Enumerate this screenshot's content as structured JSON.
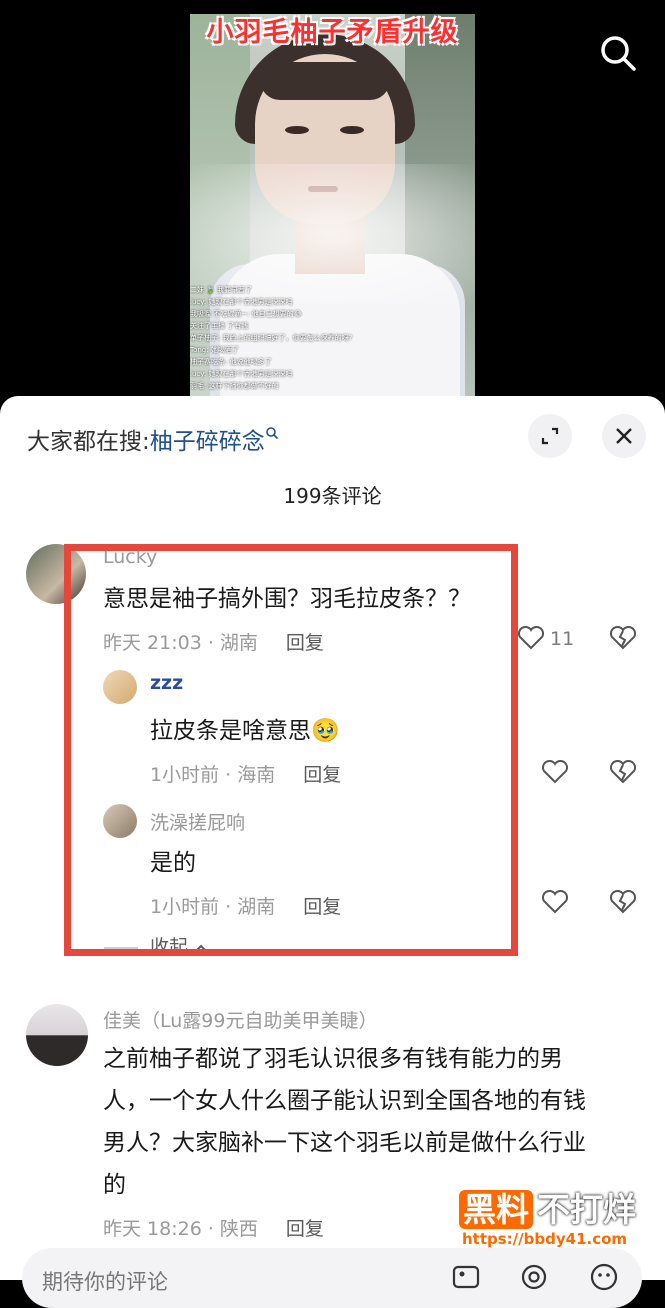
{
  "video": {
    "title": "小羽毛柚子矛盾升级",
    "live_comments": [
      "二妹 🍃  我要录音了",
      "lucy: 她现在那个香港男是深深吗",
      "我吸溜 不吃碳滴~: 他自己想要的😂",
      "关注了主播 了有钱",
      "单子柚子: 我脸上的组织搞好了，你要怎么保养的呀?",
      "Tong: 她喝酒了",
      "柚子赛吃条: 他说他喝多了",
      "lucy: 她现在那个香港男是深深吗",
      "羽毛: 这样下播你都做不好的"
    ]
  },
  "header": {
    "hot_search_label": "大家都在搜:",
    "hot_search_keyword": "柚子碎碎念",
    "comment_count": "199条评论"
  },
  "comments": [
    {
      "name": "Lucky",
      "text": "意思是袖子搞外围？羽毛拉皮条？？",
      "meta": "昨天 21:03 · 湖南",
      "reply_label": "回复",
      "likes": "11",
      "replies": [
        {
          "name": "zzz",
          "text": "拉皮条是啥意思🥹",
          "meta": "1小时前 · 海南",
          "reply_label": "回复"
        },
        {
          "name": "洗澡搓屁响",
          "text": "是的",
          "meta": "1小时前 · 湖南",
          "reply_label": "回复"
        }
      ],
      "collapse_label": "收起"
    },
    {
      "name": "佳美（Lu露99元自助美甲美睫）",
      "text_lines": [
        "之前柚子都说了羽毛认识很多有钱有能力的男",
        "人，一个女人什么圈子能认识到全国各地的有钱",
        "男人？大家脑补一下这个羽毛以前是做什么行业",
        "的"
      ],
      "meta": "昨天 18:26 · 陕西",
      "reply_label": "回复"
    }
  ],
  "input": {
    "placeholder": "期待你的评论"
  },
  "watermark": {
    "brand_a": "黑料",
    "brand_b": "不打烊",
    "url": "https://bbdy41.com"
  },
  "colors": {
    "highlight_border": "#e4473b",
    "keyword_blue": "#1f4f8f",
    "watermark_orange": "#ff6a00"
  }
}
